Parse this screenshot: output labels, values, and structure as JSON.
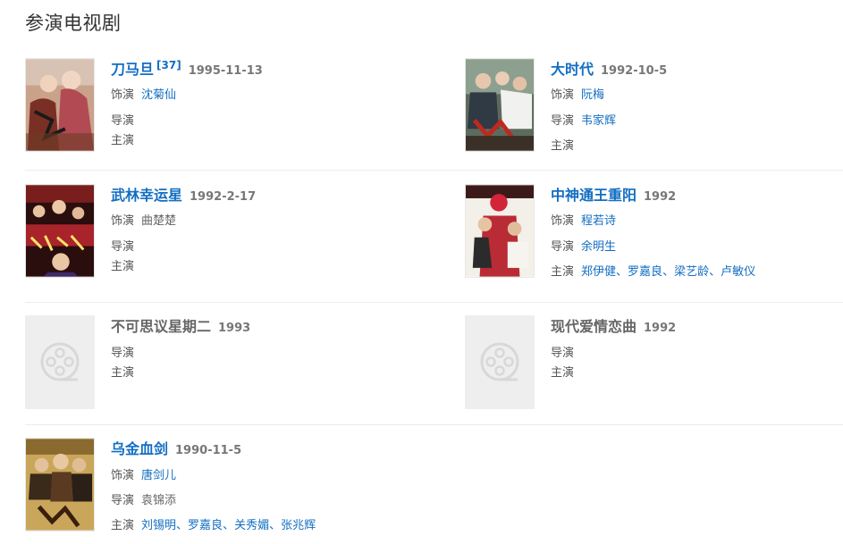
{
  "section_title": "参演电视剧",
  "labels": {
    "role": "饰演",
    "director": "导演",
    "cast": "主演"
  },
  "items": [
    {
      "title": "刀马旦",
      "sup": "[37]",
      "date": "1995-11-13",
      "role": "沈菊仙",
      "director": "",
      "cast": "",
      "poster_icon": "poster-image"
    },
    {
      "title": "大时代",
      "date": "1992-10-5",
      "role": "阮梅",
      "director": "韦家辉",
      "cast": "",
      "poster_icon": "poster-image"
    },
    {
      "title": "武林幸运星",
      "date": "1992-2-17",
      "role": "曲楚楚",
      "director": "",
      "cast": "",
      "poster_icon": "poster-image"
    },
    {
      "title": "中神通王重阳",
      "date": "1992",
      "role": "程若诗",
      "director": "余明生",
      "cast": [
        "郑伊健",
        "罗嘉良",
        "梁艺龄",
        "卢敏仪"
      ],
      "poster_icon": "poster-image"
    },
    {
      "title": "不可思议星期二",
      "date": "1993",
      "director": "",
      "cast": "",
      "poster_icon": "film-reel-icon"
    },
    {
      "title": "现代爱情恋曲",
      "date": "1992",
      "director": "",
      "cast": "",
      "poster_icon": "film-reel-icon"
    },
    {
      "title": "乌金血剑",
      "date": "1990-11-5",
      "role": "唐剑儿",
      "director": "袁锦添",
      "cast": [
        "刘锡明",
        "罗嘉良",
        "关秀媚",
        "张兆辉"
      ],
      "poster_icon": "poster-image"
    }
  ],
  "cast_separator": "、",
  "colors": {
    "link": "#136ec2",
    "label": "#555555",
    "date": "#777777",
    "divider": "#ececec",
    "placeholder_bg": "#eeeeee"
  }
}
